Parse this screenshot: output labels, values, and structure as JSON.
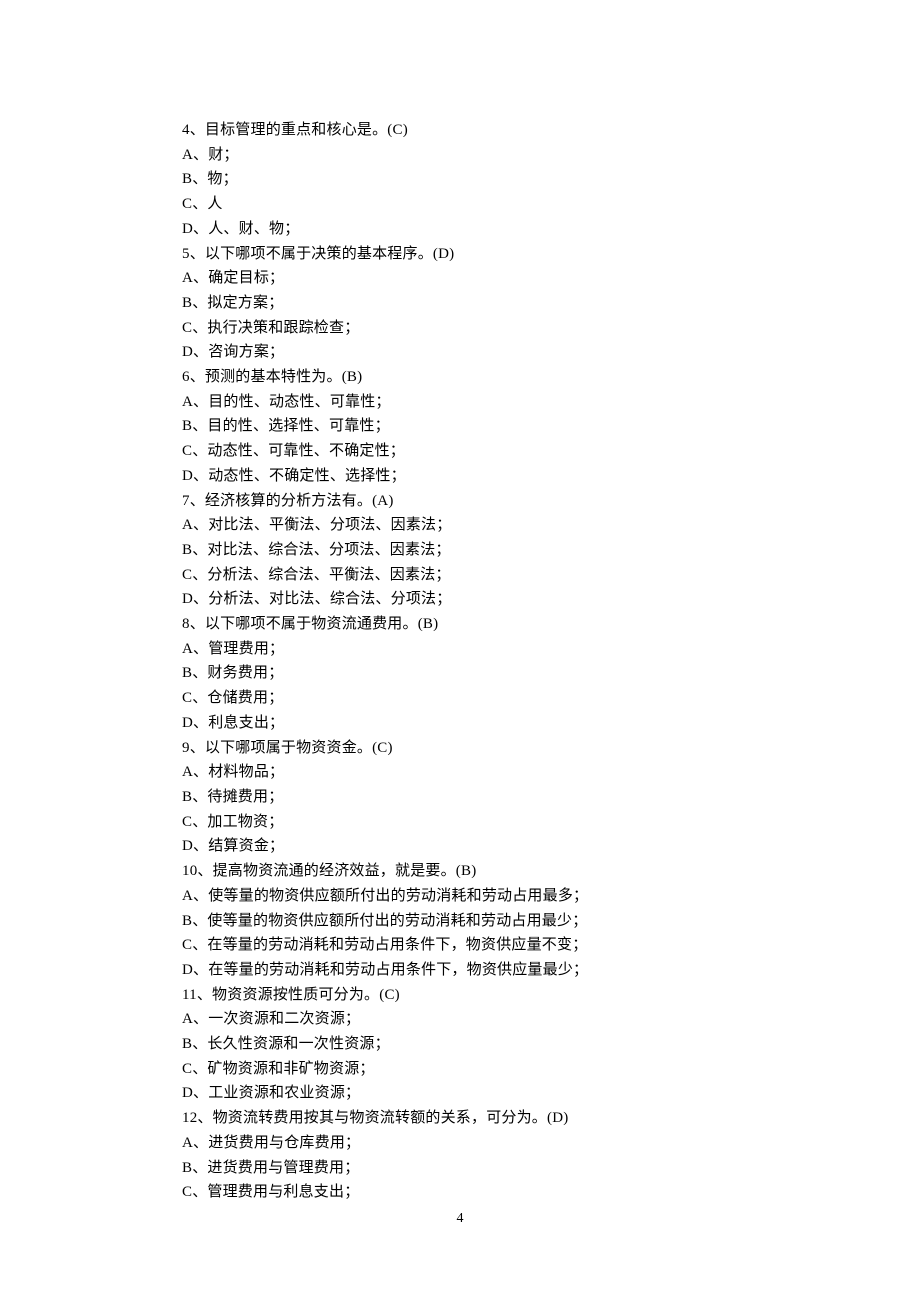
{
  "lines": [
    "4、目标管理的重点和核心是。(C)",
    "A、财；",
    "B、物；",
    "C、人",
    "D、人、财、物；",
    "5、以下哪项不属于决策的基本程序。(D)",
    "A、确定目标；",
    "B、拟定方案；",
    "C、执行决策和跟踪检查；",
    "D、咨询方案；",
    "6、预测的基本特性为。(B)",
    "A、目的性、动态性、可靠性；",
    "B、目的性、选择性、可靠性；",
    "C、动态性、可靠性、不确定性；",
    "D、动态性、不确定性、选择性；",
    "7、经济核算的分析方法有。(A)",
    "A、对比法、平衡法、分项法、因素法；",
    "B、对比法、综合法、分项法、因素法；",
    "C、分析法、综合法、平衡法、因素法；",
    "D、分析法、对比法、综合法、分项法；",
    "8、以下哪项不属于物资流通费用。(B)",
    "A、管理费用；",
    "B、财务费用；",
    "C、仓储费用；",
    "D、利息支出；",
    "9、以下哪项属于物资资金。(C)",
    "A、材料物品；",
    "B、待摊费用；",
    "C、加工物资；",
    "D、结算资金；",
    "10、提高物资流通的经济效益，就是要。(B)",
    "A、使等量的物资供应额所付出的劳动消耗和劳动占用最多；",
    "B、使等量的物资供应额所付出的劳动消耗和劳动占用最少；",
    "C、在等量的劳动消耗和劳动占用条件下，物资供应量不变；",
    "D、在等量的劳动消耗和劳动占用条件下，物资供应量最少；",
    "11、物资资源按性质可分为。(C)",
    "A、一次资源和二次资源；",
    "B、长久性资源和一次性资源；",
    "C、矿物资源和非矿物资源；",
    "D、工业资源和农业资源；",
    "12、物资流转费用按其与物资流转额的关系，可分为。(D)",
    "A、进货费用与仓库费用；",
    "B、进货费用与管理费用；",
    "C、管理费用与利息支出；"
  ],
  "page_number": "4"
}
